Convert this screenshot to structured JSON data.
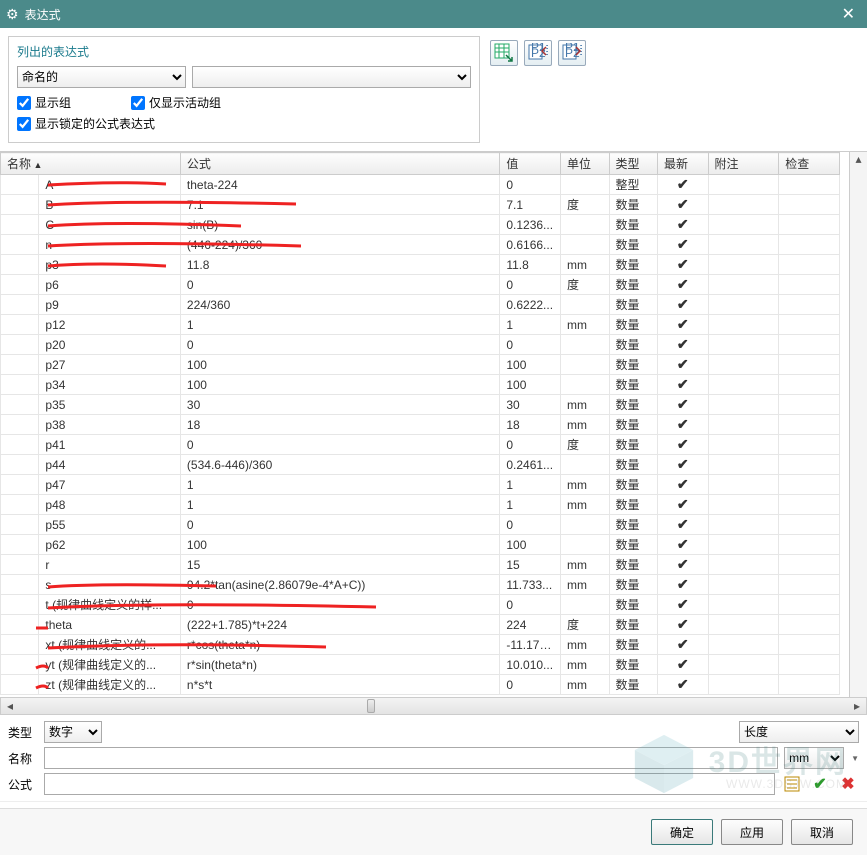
{
  "window": {
    "title": "表达式"
  },
  "filter": {
    "caption": "列出的表达式",
    "combo1": "命名的",
    "combo2": "",
    "check_show_group": "显示组",
    "check_active_only": "仅显示活动组",
    "check_show_locked": "显示锁定的公式表达式"
  },
  "columns": {
    "name": "名称",
    "formula": "公式",
    "value": "值",
    "unit": "单位",
    "type": "类型",
    "update": "最新",
    "note": "附注",
    "check": "检查"
  },
  "type_labels": {
    "int": "整型",
    "num": "数量"
  },
  "rows": [
    {
      "name": "A",
      "formula": "theta-224",
      "value": "0",
      "unit": "",
      "type": "整型"
    },
    {
      "name": "B",
      "formula": "7.1",
      "value": "7.1",
      "unit": "度",
      "type": "数量"
    },
    {
      "name": "C",
      "formula": "sin(B)",
      "value": "0.1236...",
      "unit": "",
      "type": "数量"
    },
    {
      "name": "n",
      "formula": "(446-224)/360",
      "value": "0.6166...",
      "unit": "",
      "type": "数量"
    },
    {
      "name": "p3",
      "formula": "11.8",
      "value": "11.8",
      "unit": "mm",
      "type": "数量"
    },
    {
      "name": "p6",
      "formula": "0",
      "value": "0",
      "unit": "度",
      "type": "数量"
    },
    {
      "name": "p9",
      "formula": "224/360",
      "value": "0.6222...",
      "unit": "",
      "type": "数量"
    },
    {
      "name": "p12",
      "formula": "1",
      "value": "1",
      "unit": "mm",
      "type": "数量"
    },
    {
      "name": "p20",
      "formula": "0",
      "value": "0",
      "unit": "",
      "type": "数量"
    },
    {
      "name": "p27",
      "formula": "100",
      "value": "100",
      "unit": "",
      "type": "数量"
    },
    {
      "name": "p34",
      "formula": "100",
      "value": "100",
      "unit": "",
      "type": "数量"
    },
    {
      "name": "p35",
      "formula": "30",
      "value": "30",
      "unit": "mm",
      "type": "数量"
    },
    {
      "name": "p38",
      "formula": "18",
      "value": "18",
      "unit": "mm",
      "type": "数量"
    },
    {
      "name": "p41",
      "formula": "0",
      "value": "0",
      "unit": "度",
      "type": "数量"
    },
    {
      "name": "p44",
      "formula": "(534.6-446)/360",
      "value": "0.2461...",
      "unit": "",
      "type": "数量"
    },
    {
      "name": "p47",
      "formula": "1",
      "value": "1",
      "unit": "mm",
      "type": "数量"
    },
    {
      "name": "p48",
      "formula": "1",
      "value": "1",
      "unit": "mm",
      "type": "数量"
    },
    {
      "name": "p55",
      "formula": "0",
      "value": "0",
      "unit": "",
      "type": "数量"
    },
    {
      "name": "p62",
      "formula": "100",
      "value": "100",
      "unit": "",
      "type": "数量"
    },
    {
      "name": "r",
      "formula": "15",
      "value": "15",
      "unit": "mm",
      "type": "数量"
    },
    {
      "name": "s",
      "formula": "94.2*tan(asine(2.86079e-4*A+C))",
      "value": "11.733...",
      "unit": "mm",
      "type": "数量"
    },
    {
      "name": "t  (规律曲线定义的样...",
      "formula": "0",
      "value": "0",
      "unit": "",
      "type": "数量"
    },
    {
      "name": "theta",
      "formula": "(222+1.785)*t+224",
      "value": "224",
      "unit": "度",
      "type": "数量"
    },
    {
      "name": "xt  (规律曲线定义的...",
      "formula": "r*cos(theta*n)",
      "value": "-11.170...",
      "unit": "mm",
      "type": "数量"
    },
    {
      "name": "yt  (规律曲线定义的...",
      "formula": "r*sin(theta*n)",
      "value": "10.010...",
      "unit": "mm",
      "type": "数量"
    },
    {
      "name": "zt  (规律曲线定义的...",
      "formula": "n*s*t",
      "value": "0",
      "unit": "mm",
      "type": "数量"
    }
  ],
  "edit": {
    "type_label": "类型",
    "type_value": "数字",
    "dim_value": "长度",
    "name_label": "名称",
    "name_value": "",
    "unit_value": "mm",
    "formula_label": "公式",
    "formula_value": ""
  },
  "buttons": {
    "ok": "确定",
    "apply": "应用",
    "cancel": "取消"
  },
  "watermark": {
    "text": "3D世界网",
    "sub": "WWW.3DSJW.COM"
  }
}
